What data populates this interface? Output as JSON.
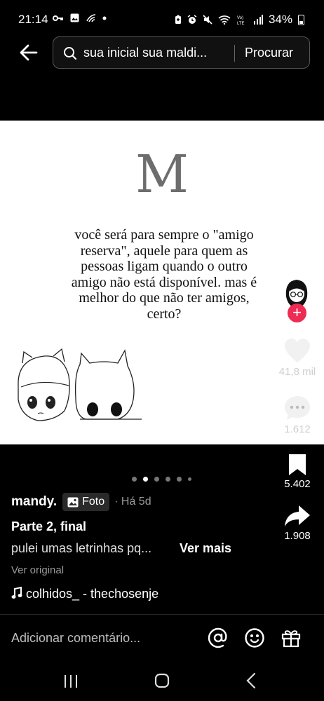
{
  "status_bar": {
    "time": "21:14",
    "battery": "34%",
    "left_icons": [
      "key-icon",
      "image-icon",
      "wifi-calling-icon",
      "dot-icon"
    ],
    "right_icons": [
      "battery-saver-icon",
      "alarm-icon",
      "mute-icon",
      "wifi-icon",
      "volte-icon",
      "signal-icon",
      "battery-icon"
    ]
  },
  "search": {
    "query": "sua inicial sua maldi...",
    "button_label": "Procurar"
  },
  "post": {
    "letter": "M",
    "quote": "você será para sempre o \"amigo reserva\", aquele para quem as pessoas ligam quando o outro amigo não está disponível. mas é melhor do que não ter amigos, certo?"
  },
  "rail": {
    "likes": "41,8 mil",
    "comments": "1.612",
    "saves": "5.402",
    "shares": "1.908"
  },
  "carousel": {
    "total": 6,
    "active_index": 1
  },
  "caption": {
    "username": "mandy.",
    "type_label": "Foto",
    "time": "· Há 5d",
    "title": "Parte 2, final",
    "text": "pulei umas letrinhas pq...",
    "see_more": "Ver mais",
    "see_original": "Ver original",
    "music": "colhidos_ - thechosenje"
  },
  "comment_bar": {
    "placeholder": "Adicionar comentário...",
    "icons": [
      "mention-icon",
      "emoji-icon",
      "gift-icon"
    ]
  },
  "colors": {
    "accent": "#ee2b52",
    "background": "#000000"
  }
}
